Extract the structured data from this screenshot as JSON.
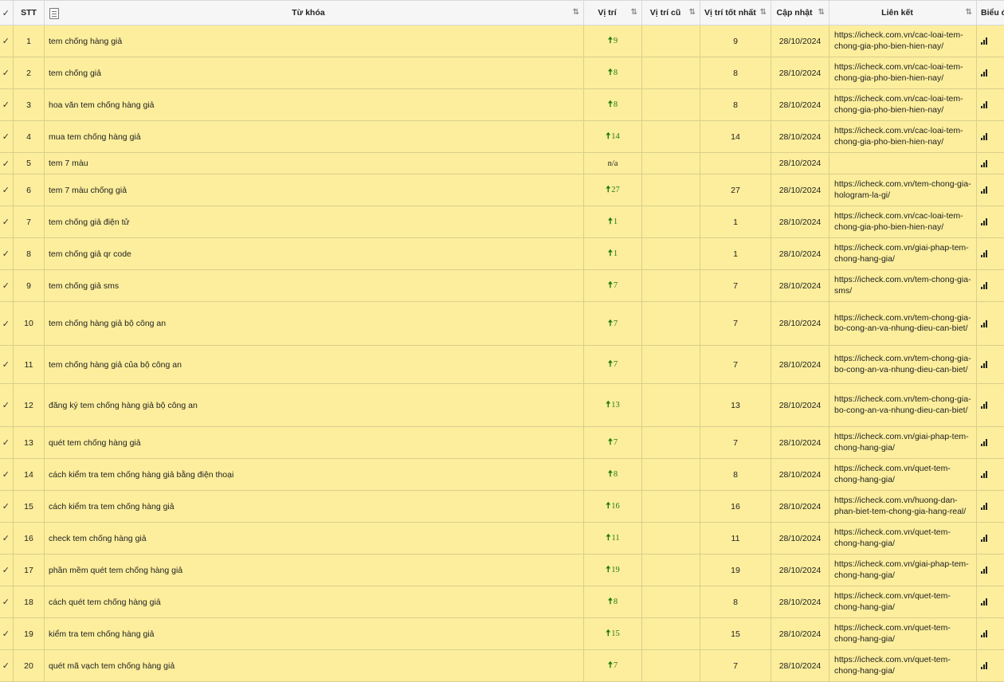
{
  "header": {
    "checkbox": "☑",
    "stt": "STT",
    "keyword": "Từ khóa",
    "position": "Vị trí",
    "old_position": "Vị trí cũ",
    "best_position": "Vị trí tốt nhất",
    "updated": "Cập nhật",
    "link": "Liên kết",
    "chart": "Biểu đ",
    "sort_icon": "sort-arrows-icon",
    "export_icon": "document-icon"
  },
  "colors": {
    "row_bg": "#fcee9c",
    "up_arrow": "#1f7a10"
  },
  "rows": [
    {
      "stt": "1",
      "keyword": "tem chống hàng giả",
      "pos": "9",
      "old": "",
      "best": "9",
      "date": "28/10/2024",
      "link": "https://icheck.com.vn/cac-loai-tem-chong-gia-pho-bien-hien-nay/",
      "h": 40
    },
    {
      "stt": "2",
      "keyword": "tem chống giả",
      "pos": "8",
      "old": "",
      "best": "8",
      "date": "28/10/2024",
      "link": "https://icheck.com.vn/cac-loai-tem-chong-gia-pho-bien-hien-nay/",
      "h": 40
    },
    {
      "stt": "3",
      "keyword": "hoa văn tem chống hàng giả",
      "pos": "8",
      "old": "",
      "best": "8",
      "date": "28/10/2024",
      "link": "https://icheck.com.vn/cac-loai-tem-chong-gia-pho-bien-hien-nay/",
      "h": 40
    },
    {
      "stt": "4",
      "keyword": "mua tem chống hàng giả",
      "pos": "14",
      "old": "",
      "best": "14",
      "date": "28/10/2024",
      "link": "https://icheck.com.vn/cac-loai-tem-chong-gia-pho-bien-hien-nay/",
      "h": 40
    },
    {
      "stt": "5",
      "keyword": "tem 7 màu",
      "pos": "n/a",
      "old": "",
      "best": "",
      "date": "28/10/2024",
      "link": "",
      "h": 27
    },
    {
      "stt": "6",
      "keyword": "tem 7 màu chống giả",
      "pos": "27",
      "old": "",
      "best": "27",
      "date": "28/10/2024",
      "link": "https://icheck.com.vn/tem-chong-gia-hologram-la-gi/",
      "h": 40
    },
    {
      "stt": "7",
      "keyword": "tem chống giả điện tử",
      "pos": "1",
      "old": "",
      "best": "1",
      "date": "28/10/2024",
      "link": "https://icheck.com.vn/cac-loai-tem-chong-gia-pho-bien-hien-nay/",
      "h": 40
    },
    {
      "stt": "8",
      "keyword": "tem chống giả qr code",
      "pos": "1",
      "old": "",
      "best": "1",
      "date": "28/10/2024",
      "link": "https://icheck.com.vn/giai-phap-tem-chong-hang-gia/",
      "h": 40
    },
    {
      "stt": "9",
      "keyword": "tem chống giả sms",
      "pos": "7",
      "old": "",
      "best": "7",
      "date": "28/10/2024",
      "link": "https://icheck.com.vn/tem-chong-gia-sms/",
      "h": 40
    },
    {
      "stt": "10",
      "keyword": "tem chống hàng giả bộ công an",
      "pos": "7",
      "old": "",
      "best": "7",
      "date": "28/10/2024",
      "link": "https://icheck.com.vn/tem-chong-gia-bo-cong-an-va-nhung-dieu-can-biet/",
      "h": 55
    },
    {
      "stt": "11",
      "keyword": "tem chống hàng giả của bộ công an",
      "pos": "7",
      "old": "",
      "best": "7",
      "date": "28/10/2024",
      "link": "https://icheck.com.vn/tem-chong-gia-bo-cong-an-va-nhung-dieu-can-biet/",
      "h": 48
    },
    {
      "stt": "12",
      "keyword": "đăng ký tem chống hàng giả bộ công an",
      "pos": "13",
      "old": "",
      "best": "13",
      "date": "28/10/2024",
      "link": "https://icheck.com.vn/tem-chong-gia-bo-cong-an-va-nhung-dieu-can-biet/",
      "h": 54
    },
    {
      "stt": "13",
      "keyword": "quét tem chống hàng giả",
      "pos": "7",
      "old": "",
      "best": "7",
      "date": "28/10/2024",
      "link": "https://icheck.com.vn/giai-phap-tem-chong-hang-gia/",
      "h": 40
    },
    {
      "stt": "14",
      "keyword": "cách kiểm tra tem chống hàng giả bằng điện thoại",
      "pos": "8",
      "old": "",
      "best": "8",
      "date": "28/10/2024",
      "link": "https://icheck.com.vn/quet-tem-chong-hang-gia/",
      "h": 40
    },
    {
      "stt": "15",
      "keyword": "cách kiểm tra tem chống hàng giả",
      "pos": "16",
      "old": "",
      "best": "16",
      "date": "28/10/2024",
      "link": "https://icheck.com.vn/huong-dan-phan-biet-tem-chong-gia-hang-real/",
      "h": 40
    },
    {
      "stt": "16",
      "keyword": "check tem chống hàng giả",
      "pos": "11",
      "old": "",
      "best": "11",
      "date": "28/10/2024",
      "link": "https://icheck.com.vn/quet-tem-chong-hang-gia/",
      "h": 40
    },
    {
      "stt": "17",
      "keyword": "phần mềm quét tem chống hàng giả",
      "pos": "19",
      "old": "",
      "best": "19",
      "date": "28/10/2024",
      "link": "https://icheck.com.vn/giai-phap-tem-chong-hang-gia/",
      "h": 40
    },
    {
      "stt": "18",
      "keyword": "cách quét tem chống hàng giả",
      "pos": "8",
      "old": "",
      "best": "8",
      "date": "28/10/2024",
      "link": "https://icheck.com.vn/quet-tem-chong-hang-gia/",
      "h": 40
    },
    {
      "stt": "19",
      "keyword": "kiểm tra tem chống hàng giả",
      "pos": "15",
      "old": "",
      "best": "15",
      "date": "28/10/2024",
      "link": "https://icheck.com.vn/quet-tem-chong-hang-gia/",
      "h": 40
    },
    {
      "stt": "20",
      "keyword": "quét mã vạch tem chống hàng giả",
      "pos": "7",
      "old": "",
      "best": "7",
      "date": "28/10/2024",
      "link": "https://icheck.com.vn/quet-tem-chong-hang-gia/",
      "h": 40
    }
  ]
}
